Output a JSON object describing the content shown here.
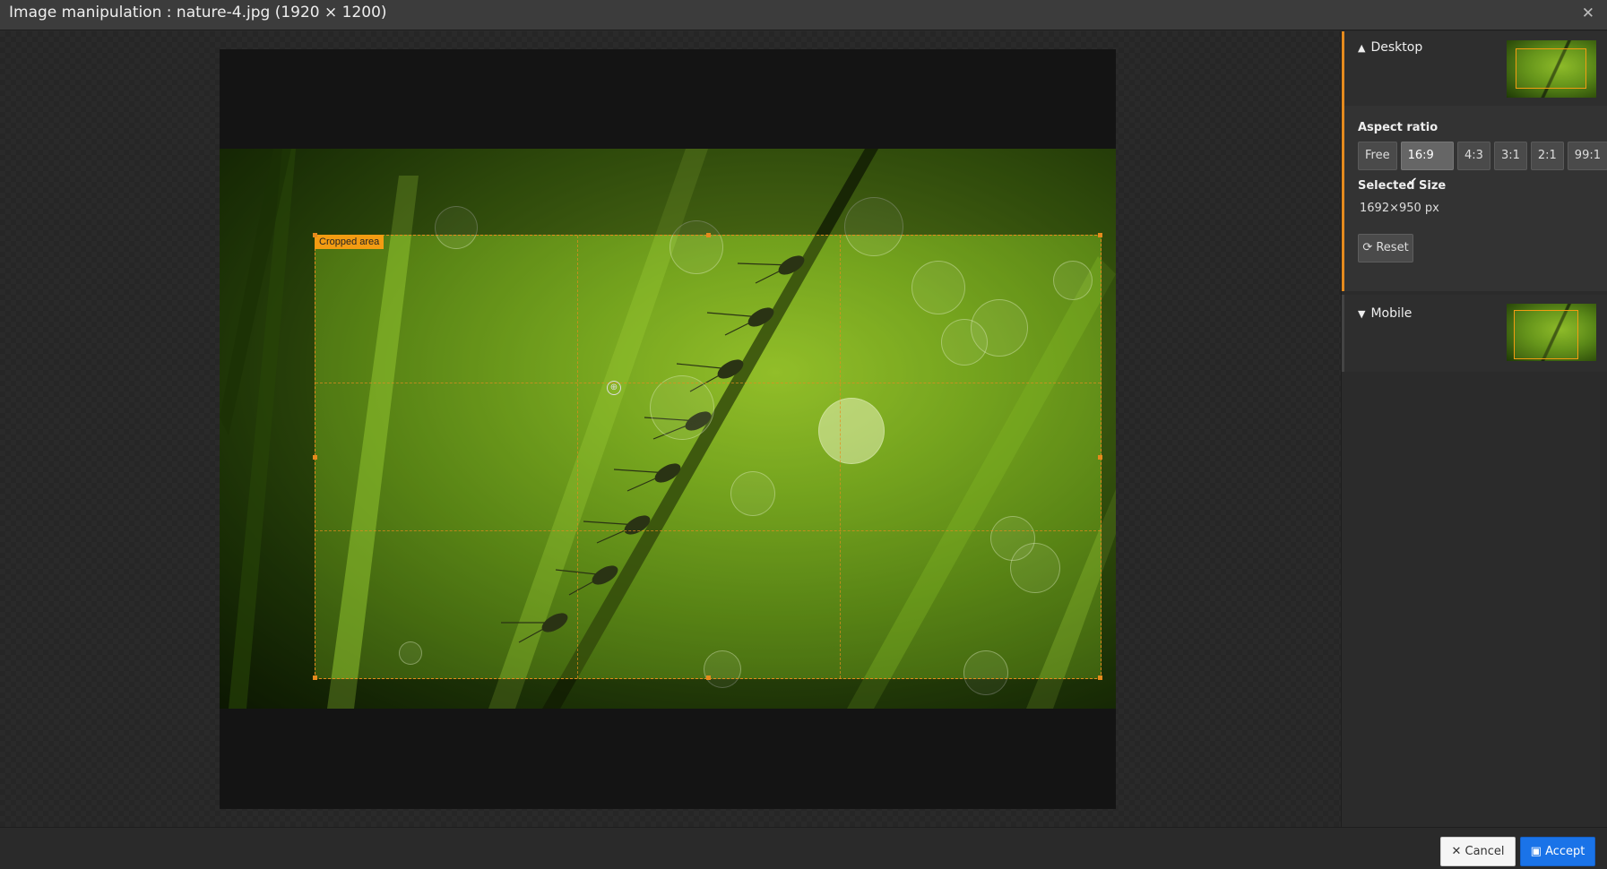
{
  "window": {
    "title": "Image manipulation : nature-4.jpg (1920 × 1200)",
    "close_icon": "close-icon"
  },
  "editor": {
    "crop_label": "Cropped area",
    "focus_icon": "focus-point-icon"
  },
  "sidebar": {
    "desktop": {
      "title": "Desktop",
      "chevron": "chevron-up-icon",
      "aspect_ratio_label": "Aspect ratio",
      "ratios": [
        {
          "label": "Free",
          "active": false
        },
        {
          "label": "16:9",
          "active": true,
          "check": "✔"
        },
        {
          "label": "4:3",
          "active": false
        },
        {
          "label": "3:1",
          "active": false
        },
        {
          "label": "2:1",
          "active": false
        },
        {
          "label": "99:1",
          "active": false
        }
      ],
      "selected_size_label": "Selected Size",
      "selected_size_value": "1692×950 px",
      "reset_label": "Reset",
      "reset_icon": "refresh-icon"
    },
    "mobile": {
      "title": "Mobile",
      "chevron": "chevron-down-icon"
    }
  },
  "footer": {
    "cancel_label": "Cancel",
    "cancel_icon": "close-icon",
    "accept_label": "Accept",
    "accept_icon": "save-icon"
  },
  "colors": {
    "accent": "#e58a1d",
    "primary": "#1a73e8"
  }
}
